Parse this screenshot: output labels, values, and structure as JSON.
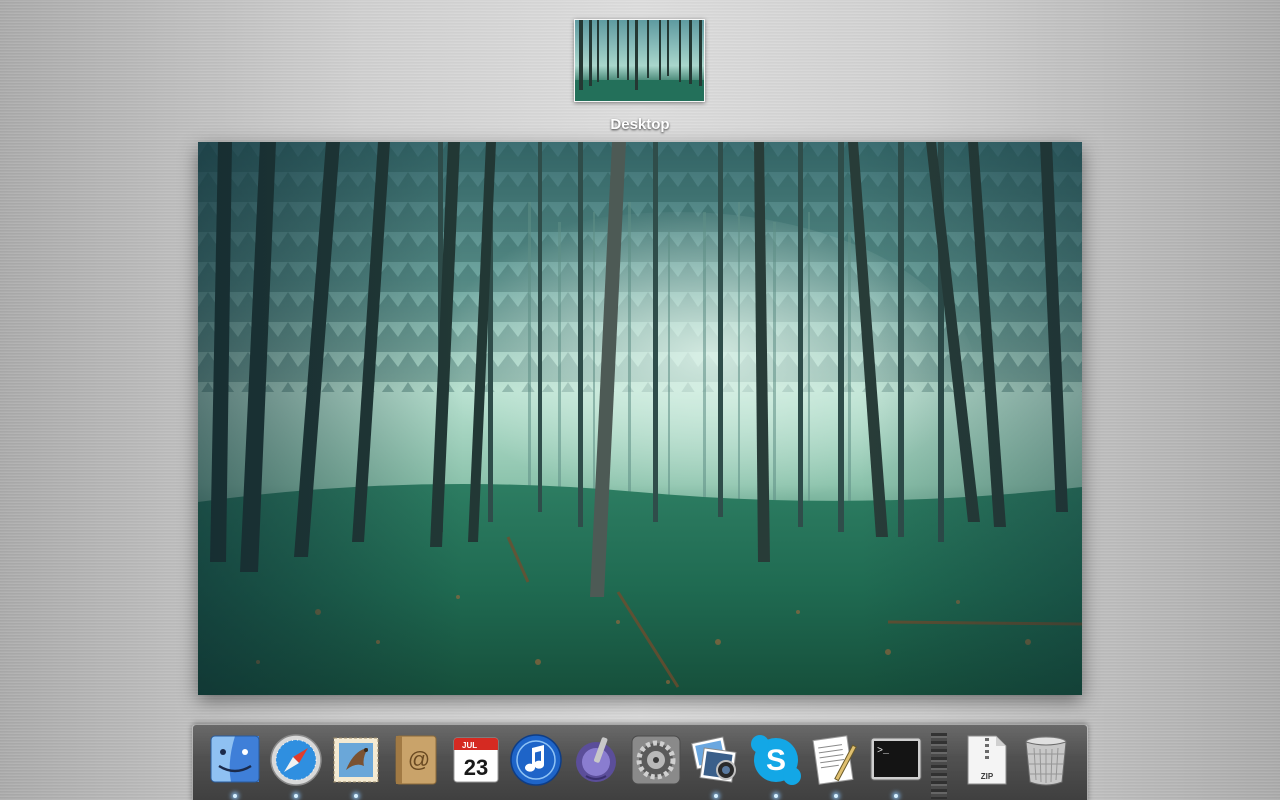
{
  "space": {
    "label": "Desktop"
  },
  "dock": {
    "items": [
      {
        "name": "finder",
        "icon": "finder-icon",
        "running": true
      },
      {
        "name": "safari",
        "icon": "safari-icon",
        "running": true
      },
      {
        "name": "mail",
        "icon": "mail-icon",
        "running": true
      },
      {
        "name": "address-book",
        "icon": "address-book-icon",
        "running": false
      },
      {
        "name": "ical",
        "icon": "calendar-icon",
        "running": false,
        "month": "JUL",
        "day": "23"
      },
      {
        "name": "itunes",
        "icon": "itunes-icon",
        "running": false
      },
      {
        "name": "preview",
        "icon": "preview-icon",
        "running": false
      },
      {
        "name": "system-preferences",
        "icon": "system-preferences-icon",
        "running": false
      },
      {
        "name": "iphoto",
        "icon": "iphoto-icon",
        "running": true
      },
      {
        "name": "skype",
        "icon": "skype-icon",
        "running": true
      },
      {
        "name": "textedit",
        "icon": "textedit-icon",
        "running": true
      },
      {
        "name": "terminal",
        "icon": "terminal-icon",
        "running": true
      },
      {
        "name": "zip-stack",
        "icon": "zip-file-icon",
        "running": false,
        "label": "ZIP"
      },
      {
        "name": "trash",
        "icon": "trash-icon",
        "running": false
      }
    ]
  },
  "colors": {
    "dock_bg": "#474747",
    "desktop_bg": "#c8c8c8",
    "forest_moss": "#2f8a6a",
    "forest_fog": "#bfe3d6"
  }
}
